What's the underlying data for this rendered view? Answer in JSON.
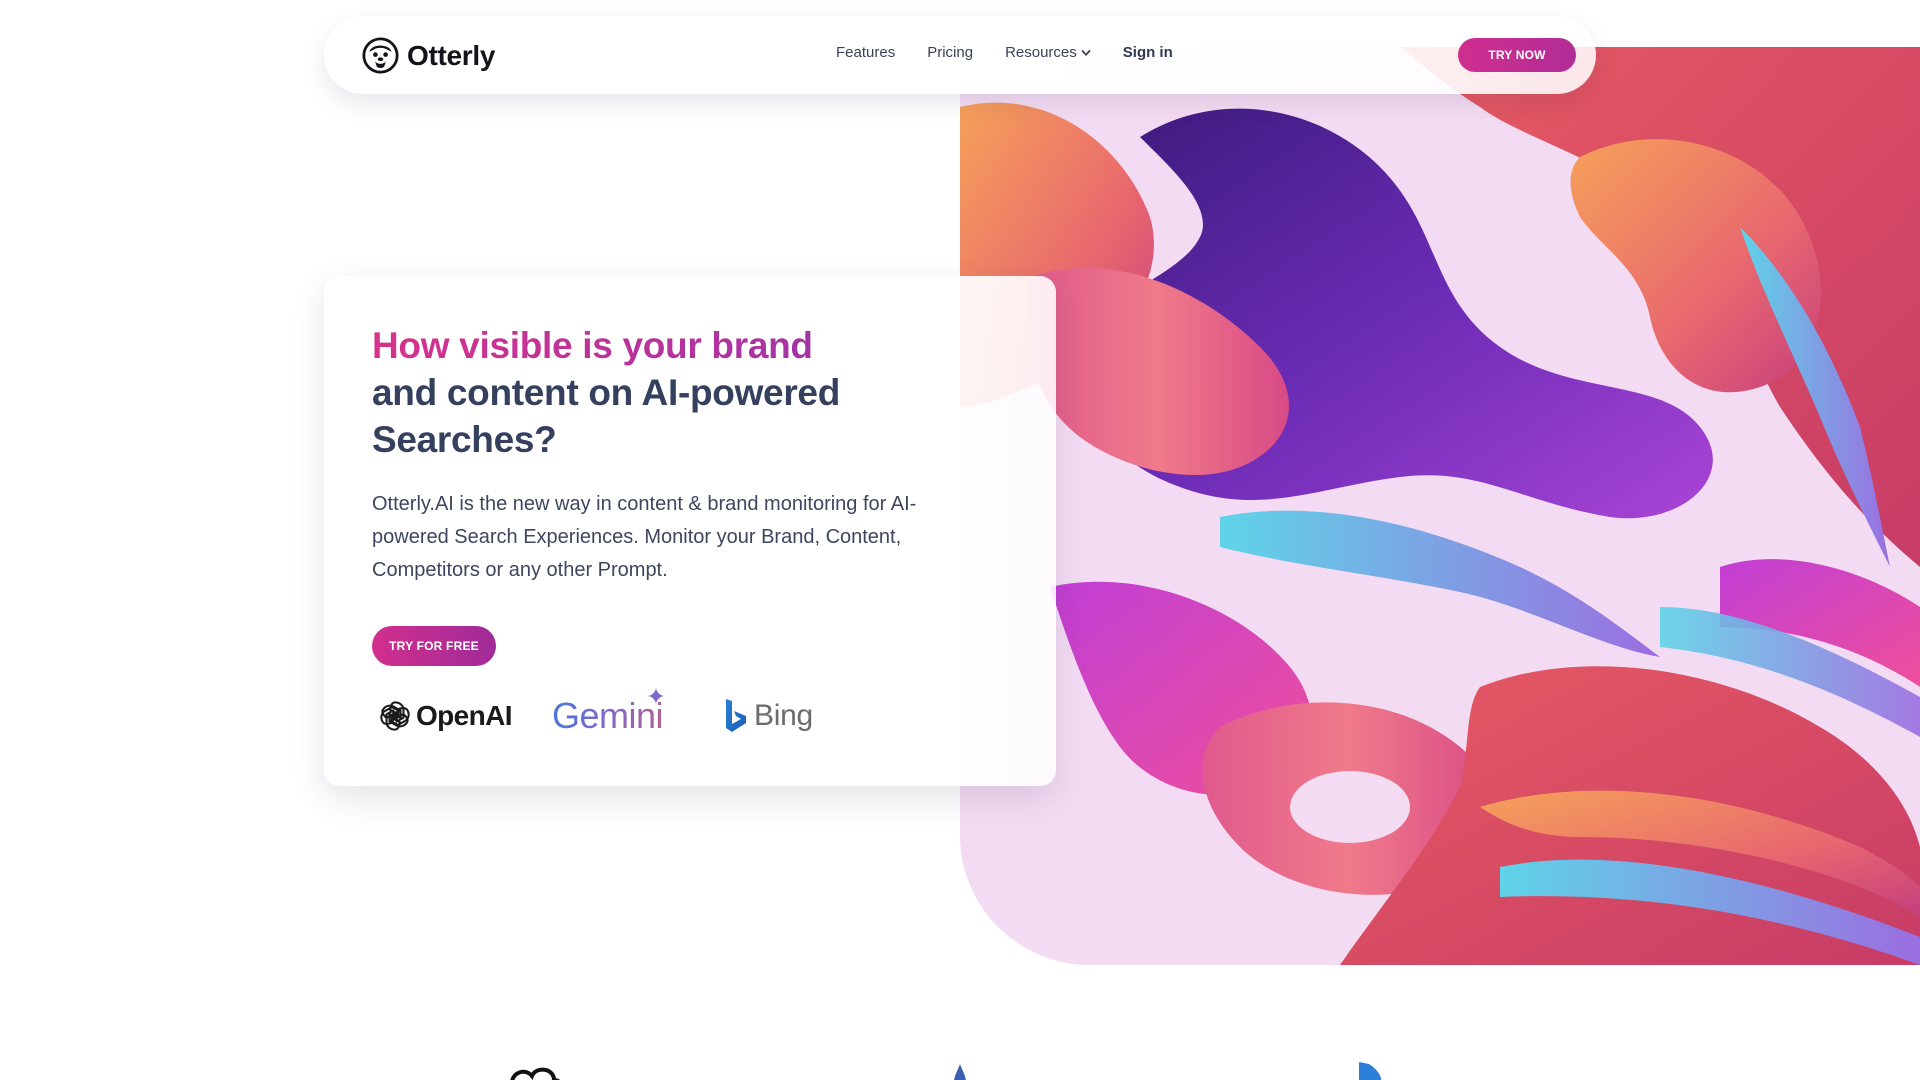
{
  "nav": {
    "brand_name": "Otterly",
    "links": [
      {
        "label": "Features"
      },
      {
        "label": "Pricing"
      },
      {
        "label": "Resources"
      },
      {
        "label": "Sign in"
      }
    ],
    "cta_label": "TRY NOW"
  },
  "hero": {
    "headline_accent": "How visible is your brand",
    "headline_rest": "and content on AI-powered Searches?",
    "subtext": "Otterly.AI is the new way in content & brand monitoring for AI-powered Search Experiences. Monitor your Brand, Content, Competitors or any other Prompt.",
    "cta_label": "TRY FOR FREE",
    "partners": [
      {
        "name": "OpenAI",
        "icon": "openai-icon"
      },
      {
        "name": "Gemini",
        "icon": "gemini-spark-icon"
      },
      {
        "name": "Bing",
        "icon": "bing-icon"
      }
    ]
  },
  "colors": {
    "accent": "#d02e8e",
    "accent_secondary": "#a02b9a",
    "heading": "#34405e",
    "body_text": "#3d465e"
  }
}
